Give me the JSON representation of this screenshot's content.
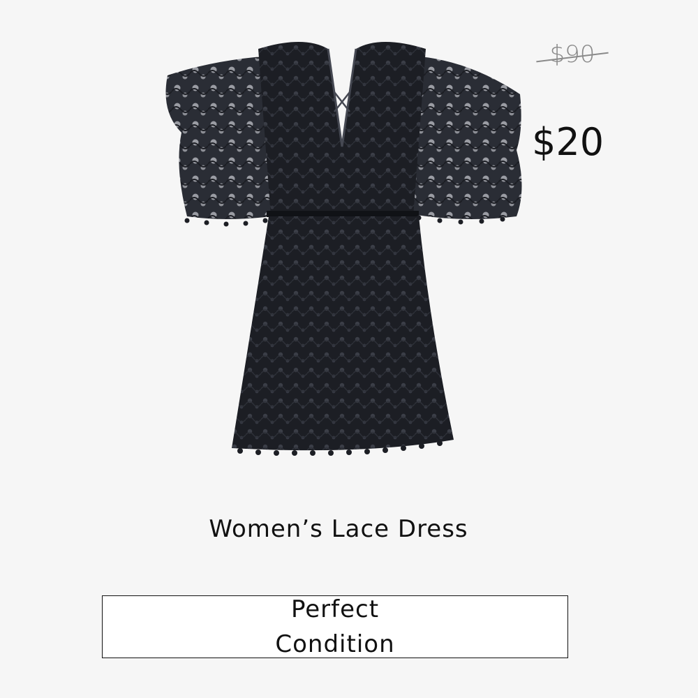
{
  "product": {
    "image_alt": "black lace dress with flutter sleeves and plunging V-neck",
    "original_price": "$90",
    "sale_price": "$20",
    "title": "Women’s Lace Dress",
    "condition": {
      "line1": "Perfect",
      "line2": "Condition"
    }
  },
  "colors": {
    "background": "#f6f6f6",
    "dress": "#1c1e24",
    "strikethrough": "#8a8a8a",
    "text": "#111111"
  }
}
